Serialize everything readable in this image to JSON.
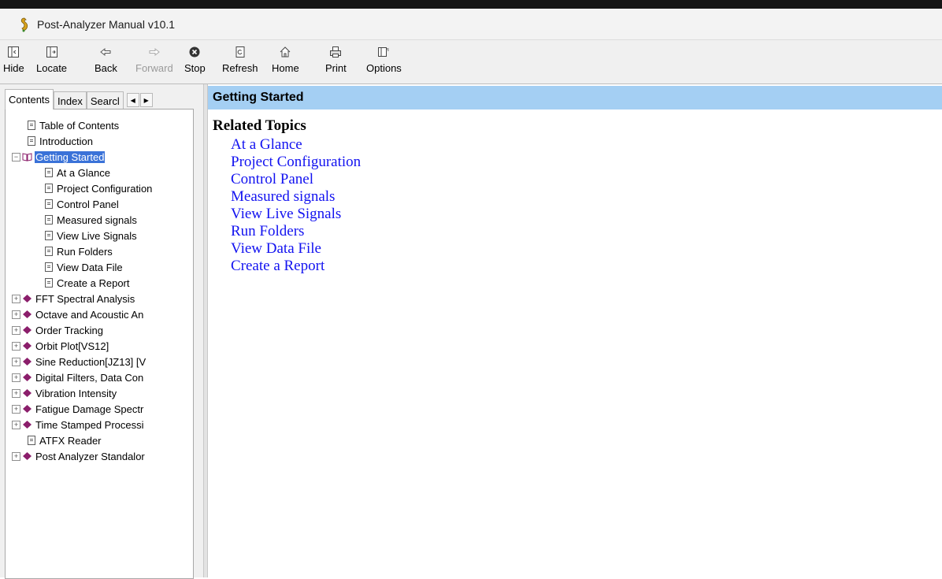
{
  "window": {
    "title": "Post-Analyzer Manual v10.1"
  },
  "toolbar": {
    "buttons": [
      {
        "label": "Hide",
        "icon": "hide-icon"
      },
      {
        "label": "Locate",
        "icon": "locate-icon"
      },
      {
        "label": "Back",
        "icon": "back-arrow-icon"
      },
      {
        "label": "Forward",
        "icon": "forward-arrow-icon"
      },
      {
        "label": "Stop",
        "icon": "stop-icon"
      },
      {
        "label": "Refresh",
        "icon": "refresh-icon"
      },
      {
        "label": "Home",
        "icon": "home-icon"
      },
      {
        "label": "Print",
        "icon": "print-icon"
      },
      {
        "label": "Options",
        "icon": "options-icon"
      }
    ]
  },
  "nav_tabs": {
    "contents": "Contents",
    "index": "Index",
    "search": "Searcl"
  },
  "tree": {
    "items": [
      "Table of Contents",
      "Introduction",
      "Getting Started",
      "At a Glance",
      "Project Configuration",
      "Control Panel",
      "Measured signals",
      "View Live Signals",
      "Run Folders",
      "View Data File",
      "Create a Report",
      "FFT Spectral Analysis",
      "Octave and Acoustic An",
      "Order Tracking",
      "Orbit Plot[VS12]",
      "Sine Reduction[JZ13] [V",
      "Digital Filters, Data Con",
      "Vibration Intensity",
      "Fatigue Damage Spectr",
      "Time Stamped Processi",
      "ATFX Reader",
      "Post Analyzer Standalor"
    ]
  },
  "content": {
    "header": "Getting Started",
    "related_title": "Related Topics",
    "links": [
      "At a Glance",
      "Project Configuration",
      "Control Panel",
      "Measured signals",
      "View Live Signals",
      "Run Folders",
      "View Data File",
      "Create a Report"
    ]
  },
  "colors": {
    "header_bg": "#a4cff3",
    "link": "#1212f0",
    "selection": "#3a72d8",
    "book": "#8b1e6b"
  }
}
